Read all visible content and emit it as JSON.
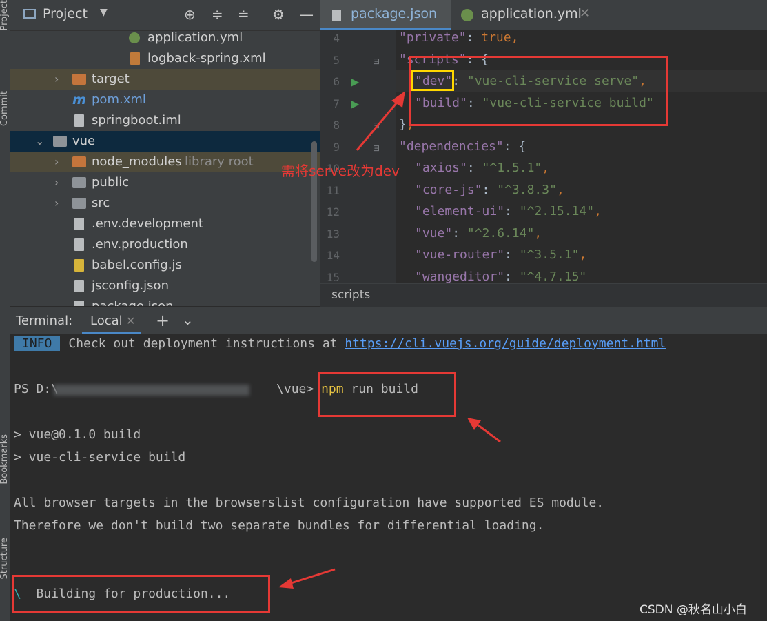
{
  "sidebar_tabs": {
    "project": "Project",
    "commit": "Commit",
    "bookmarks": "Bookmarks",
    "structure": "Structure"
  },
  "project": {
    "title": "Project",
    "tree": [
      {
        "label": "application.yml",
        "icon": "spring-yml-icon"
      },
      {
        "label": "logback-spring.xml",
        "icon": "xml-file-icon"
      },
      {
        "label": "target",
        "icon": "folder-orange-icon"
      },
      {
        "label": "pom.xml",
        "icon": "maven-icon"
      },
      {
        "label": "springboot.iml",
        "icon": "iml-file-icon"
      },
      {
        "label": "vue",
        "icon": "folder-icon"
      },
      {
        "label": "node_modules",
        "hint": "library root",
        "icon": "folder-orange-icon"
      },
      {
        "label": "public",
        "icon": "folder-icon"
      },
      {
        "label": "src",
        "icon": "folder-icon"
      },
      {
        "label": ".env.development",
        "icon": "file-icon"
      },
      {
        "label": ".env.production",
        "icon": "file-icon"
      },
      {
        "label": "babel.config.js",
        "icon": "js-file-icon"
      },
      {
        "label": "jsconfig.json",
        "icon": "json-file-icon"
      },
      {
        "label": "package.json",
        "icon": "json-file-icon"
      }
    ]
  },
  "editor": {
    "tabs": [
      {
        "label": "package.json"
      },
      {
        "label": "application.yml"
      }
    ],
    "line_numbers": [
      "4",
      "5",
      "6",
      "7",
      "8",
      "9",
      "10",
      "11",
      "12",
      "13",
      "14",
      "15"
    ],
    "breadcrumb": "scripts"
  },
  "annotation": "需将serve改为dev",
  "terminal": {
    "title": "Terminal:",
    "tab": "Local",
    "info_badge": "INFO",
    "info_text": "Check out deployment instructions at",
    "info_link": "https://cli.vuejs.org/guide/deployment.html",
    "prompt": "PS D:\\",
    "prompt_end": "\\vue>",
    "cmd_npm": "npm",
    "cmd_rest": "run build",
    "out1": "> vue@0.1.0 build",
    "out2": "> vue-cli-service build",
    "out3": "All browser targets in the browserslist configuration have supported ES module.",
    "out4": "Therefore we don't build two separate bundles for differential loading.",
    "spinner": "\\",
    "building": "Building for production..."
  },
  "watermark": "CSDN @秋名山小白",
  "colors": {
    "accent_red": "#e53935",
    "highlight_yellow": "#ffd700"
  }
}
